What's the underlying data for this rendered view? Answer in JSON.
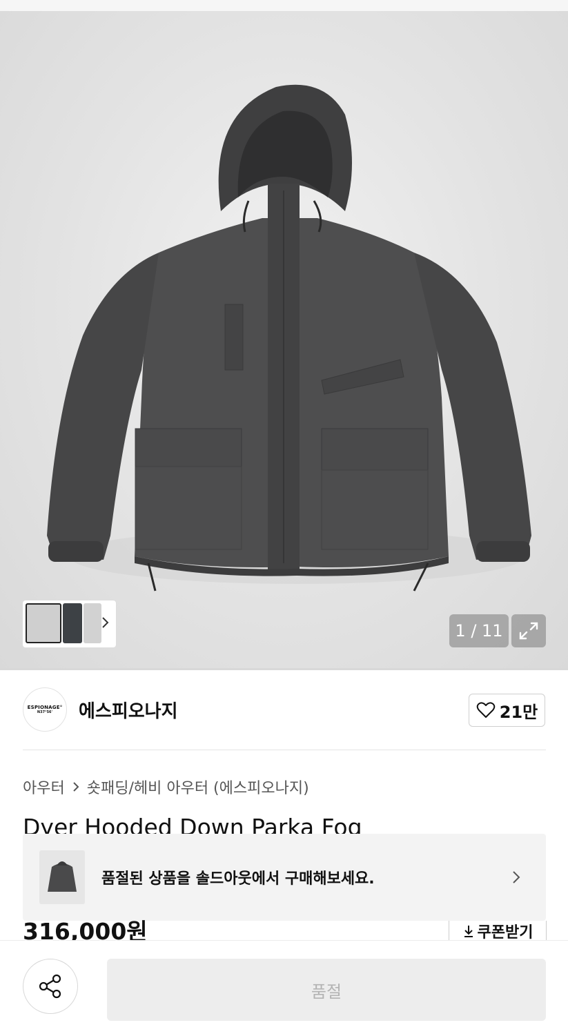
{
  "gallery": {
    "counter": "1 / 11"
  },
  "brand": {
    "logo_line1": "ESPIONAGE°",
    "logo_line2": "N37°56'",
    "name": "에스피오나지",
    "like_count": "21만"
  },
  "breadcrumb": {
    "category": "아우터",
    "subcategory": "숏패딩/헤비 아우터 (에스피오나지)"
  },
  "product": {
    "title": "Dyer Hooded Down Parka Fog",
    "price": "316,000원",
    "coupon_label": "쿠폰받기"
  },
  "soldout_banner": {
    "text": "품절된 상품을 솔드아웃에서 구매해보세요."
  },
  "bottom_bar": {
    "buy_label": "품절"
  }
}
